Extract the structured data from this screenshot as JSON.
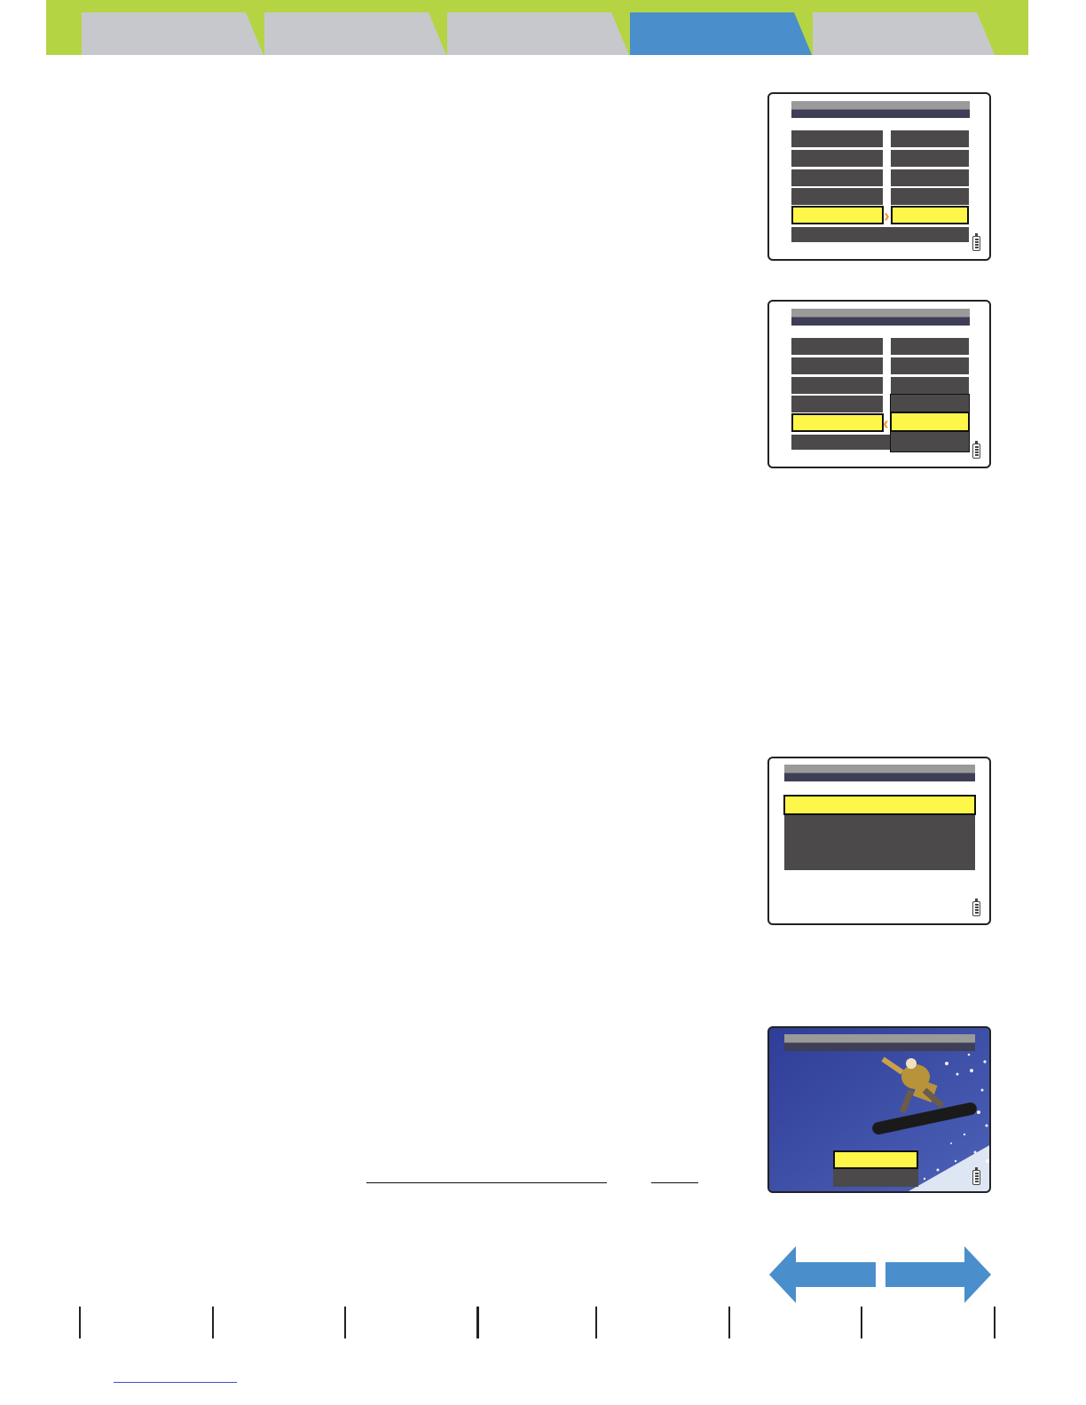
{
  "tabs": [
    {
      "label": ""
    },
    {
      "label": ""
    },
    {
      "label": ""
    },
    {
      "label": "",
      "active": true
    },
    {
      "label": ""
    }
  ],
  "colors": {
    "tabbar": "#b5d444",
    "tab_inactive": "#c7c8cc",
    "tab_active": "#4a8ecb",
    "menu_row": "#4b4949",
    "highlight": "#fff64a",
    "arrow": "#f39523",
    "nav_arrow": "#4a8ecb"
  },
  "screens": [
    {
      "name": "menu-screen-1",
      "selected_row": 5,
      "arrow": "right"
    },
    {
      "name": "menu-screen-2",
      "selected_row": 5,
      "arrow": "left",
      "dropdown_open": true
    },
    {
      "name": "menu-screen-3",
      "selected_row": 1
    },
    {
      "name": "photo-preview-screen",
      "icons": [
        "battery-icon"
      ]
    }
  ],
  "nav": {
    "prev_icon": "arrow-left-icon",
    "next_icon": "arrow-right-icon"
  },
  "footer": {
    "separators": 8
  }
}
